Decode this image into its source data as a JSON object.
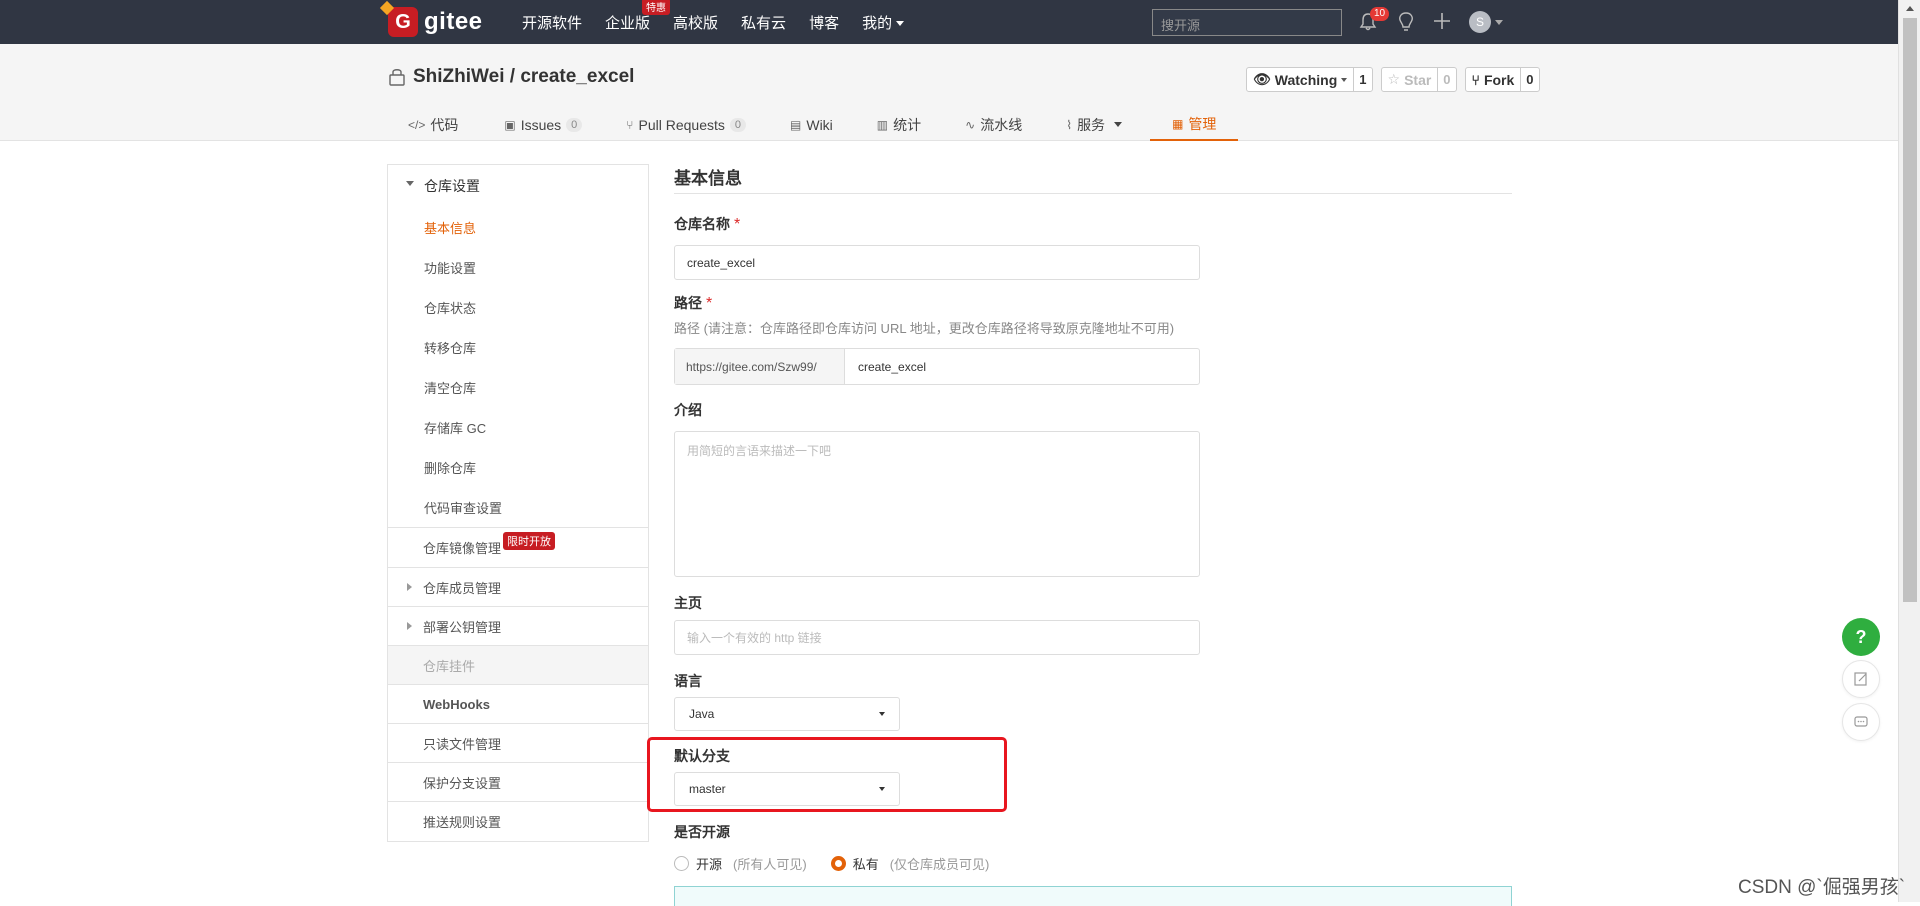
{
  "nav": {
    "logo": "gitee",
    "items": [
      "开源软件",
      "企业版",
      "高校版",
      "私有云",
      "博客",
      "我的"
    ],
    "special_badge": "特惠",
    "search_placeholder": "搜开源",
    "notif_count": "10",
    "avatar_letter": "S"
  },
  "repo": {
    "title": "ShiZhiWei / create_excel",
    "watching_label": "Watching",
    "watching_count": "1",
    "star_label": "Star",
    "star_count": "0",
    "fork_label": "Fork",
    "fork_count": "0",
    "tabs": [
      {
        "label": "代码",
        "icon": "</>"
      },
      {
        "label": "Issues",
        "count": "0",
        "icon": "▣"
      },
      {
        "label": "Pull Requests",
        "count": "0",
        "icon": "⑂"
      },
      {
        "label": "Wiki",
        "icon": "▤"
      },
      {
        "label": "统计",
        "icon": "▥"
      },
      {
        "label": "流水线",
        "icon": "∿"
      },
      {
        "label": "服务",
        "icon": "⌇"
      },
      {
        "label": "管理",
        "icon": "▦"
      }
    ],
    "active_tab": "管理"
  },
  "sidebar": {
    "section": "仓库设置",
    "items": [
      "基本信息",
      "功能设置",
      "仓库状态",
      "转移仓库",
      "清空仓库",
      "存储库 GC",
      "删除仓库",
      "代码审查设置"
    ],
    "active_item": "基本信息",
    "mirror": "仓库镜像管理",
    "mirror_badge": "限时开放",
    "members": "仓库成员管理",
    "deploy_keys": "部署公钥管理",
    "hooks_plugin": "仓库挂件",
    "webhooks": "WebHooks",
    "readonly": "只读文件管理",
    "protect_branch": "保护分支设置",
    "push_rules": "推送规则设置"
  },
  "form": {
    "title": "基本信息",
    "name_label": "仓库名称",
    "name_value": "create_excel",
    "path_label": "路径",
    "path_hint": "路径 (请注意：仓库路径即仓库访问 URL 地址，更改仓库路径将导致原克隆地址不可用)",
    "path_prefix": "https://gitee.com/Szw99/",
    "path_value": "create_excel",
    "intro_label": "介绍",
    "intro_placeholder": "用简短的言语来描述一下吧",
    "homepage_label": "主页",
    "homepage_placeholder": "输入一个有效的 http 链接",
    "lang_label": "语言",
    "lang_value": "Java",
    "branch_label": "默认分支",
    "branch_value": "master",
    "open_label": "是否开源",
    "open_option": "开源",
    "open_sub": "(所有人可见)",
    "private_option": "私有",
    "private_sub": "(仅仓库成员可见)",
    "selected_visibility": "私有"
  },
  "watermark": "CSDN @`倔强男孩`"
}
